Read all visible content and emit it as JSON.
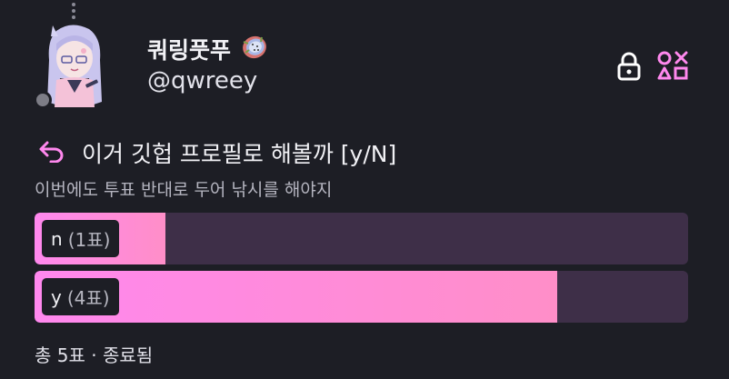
{
  "user": {
    "display_name": "쿼링풋푸",
    "handle": "@qwreey"
  },
  "poll": {
    "question": "이거 깃헙 프로필로 해볼까 [y/N]",
    "description": "이번에도 투표 반대로 두어 낚시를 해야지",
    "options": [
      {
        "label": "n",
        "votes_text": "(1표)",
        "votes": 1
      },
      {
        "label": "y",
        "votes_text": "(4표)",
        "votes": 4
      }
    ],
    "footer": "총 5표 · 종료됨"
  },
  "colors": {
    "background": "#1d1e25",
    "accent": "#ff88ee",
    "bar_track": "#3e2f48",
    "status_offline": "#7d7d86"
  },
  "icons": {
    "reply": "reply-icon",
    "lock": "lock-icon",
    "channel": "game-icon",
    "emoji": "dragonfruit-emoji-icon"
  }
}
